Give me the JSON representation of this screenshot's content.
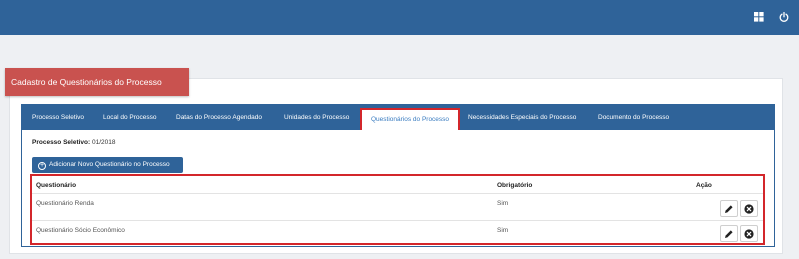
{
  "header": {
    "apps_icon": "windows-grid-icon",
    "power_icon": "power-icon"
  },
  "page": {
    "title": "Cadastro de Questionários do Processo"
  },
  "tabs": [
    {
      "label": "Processo Seletivo",
      "active": false
    },
    {
      "label": "Local do Processo",
      "active": false
    },
    {
      "label": "Datas do Processo Agendado",
      "active": false
    },
    {
      "label": "Unidades do Processo",
      "active": false
    },
    {
      "label": "Questionários do Processo",
      "active": true
    },
    {
      "label": "Necessidades Especiais do Processo",
      "active": false
    },
    {
      "label": "Documento do Processo",
      "active": false
    }
  ],
  "process": {
    "label": "Processo Seletivo:",
    "value": "01/2018"
  },
  "add_button": {
    "label": "Adicionar Novo Questionário no Processo",
    "icon": "plus-circle-icon"
  },
  "table": {
    "headers": {
      "questionario": "Questionário",
      "obrigatorio": "Obrigatório",
      "acao": "Ação"
    },
    "rows": [
      {
        "questionario": "Questionário Renda",
        "obrigatorio": "Sim"
      },
      {
        "questionario": "Questionário Sócio Econômico",
        "obrigatorio": "Sim"
      }
    ],
    "edit_icon": "pencil-icon",
    "delete_icon": "close-circle-icon"
  },
  "colors": {
    "topbar": "#2f6399",
    "title_bg": "#c9524f",
    "highlight": "#d3262b",
    "active_tab_text": "#3a7cc0"
  }
}
